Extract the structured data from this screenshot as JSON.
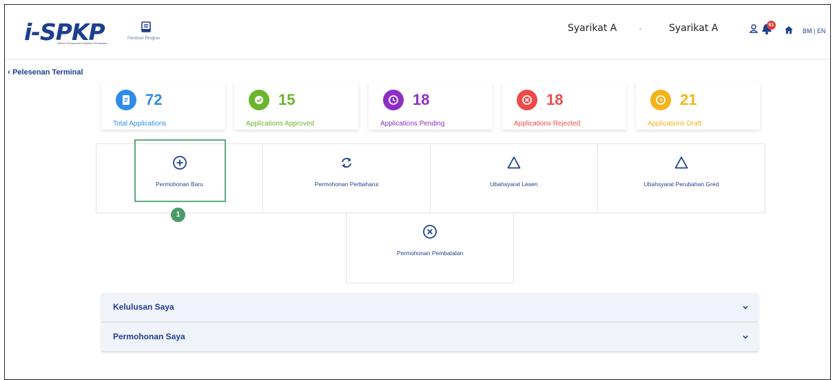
{
  "header": {
    "logo_text": "i-SPKP",
    "logo_subtitle": "Sistem Pengurusan Kawalan Perkapalan",
    "guide_label": "Panduan Ringkas",
    "company_primary": "Syarikat A",
    "company_caret": "-",
    "company_secondary": "Syarikat A",
    "notification_count": "61",
    "language_switch": "BM | EN",
    "icons": [
      "user-icon",
      "bell-icon",
      "home-icon",
      "book-icon"
    ]
  },
  "breadcrumb": {
    "back_icon": "chevron-left-icon",
    "label": "Pelesenan Terminal"
  },
  "stats": [
    {
      "value": "72",
      "label": "Total Applications",
      "color": "#2f8ce9",
      "icon": "clipboard-icon"
    },
    {
      "value": "15",
      "label": "Applications Approved",
      "color": "#6ab52d",
      "icon": "check-icon"
    },
    {
      "value": "18",
      "label": "Applications Pending",
      "color": "#8e2ec4",
      "icon": "history-icon"
    },
    {
      "value": "18",
      "label": "Applications Rejected",
      "color": "#ec4b49",
      "icon": "x-circle-icon"
    },
    {
      "value": "21",
      "label": "Applications Draft",
      "color": "#f2b31b",
      "icon": "draft-icon"
    }
  ],
  "actions": [
    {
      "label": "Permohonan Baru",
      "icon": "plus-circle-icon"
    },
    {
      "label": "Permohonan Perbaharui",
      "icon": "refresh-icon"
    },
    {
      "label": "Ubahsyarat Lesen",
      "icon": "triangle-icon"
    },
    {
      "label": "Ubahsyarat Perubahan Gred",
      "icon": "triangle-icon"
    },
    {
      "label": "Permohonan Pembatalan",
      "icon": "x-circle-icon"
    }
  ],
  "annotation_marker": "1",
  "accordions": [
    {
      "label": "Kelulusan Saya",
      "icon": "chevron-down-icon"
    },
    {
      "label": "Permohonan Saya",
      "icon": "chevron-down-icon"
    }
  ],
  "colors": {
    "brand": "#1d3f8f",
    "highlight": "#5ea77e",
    "marker": "#4b9b68",
    "accordion_bg": "#f1f3fa"
  }
}
